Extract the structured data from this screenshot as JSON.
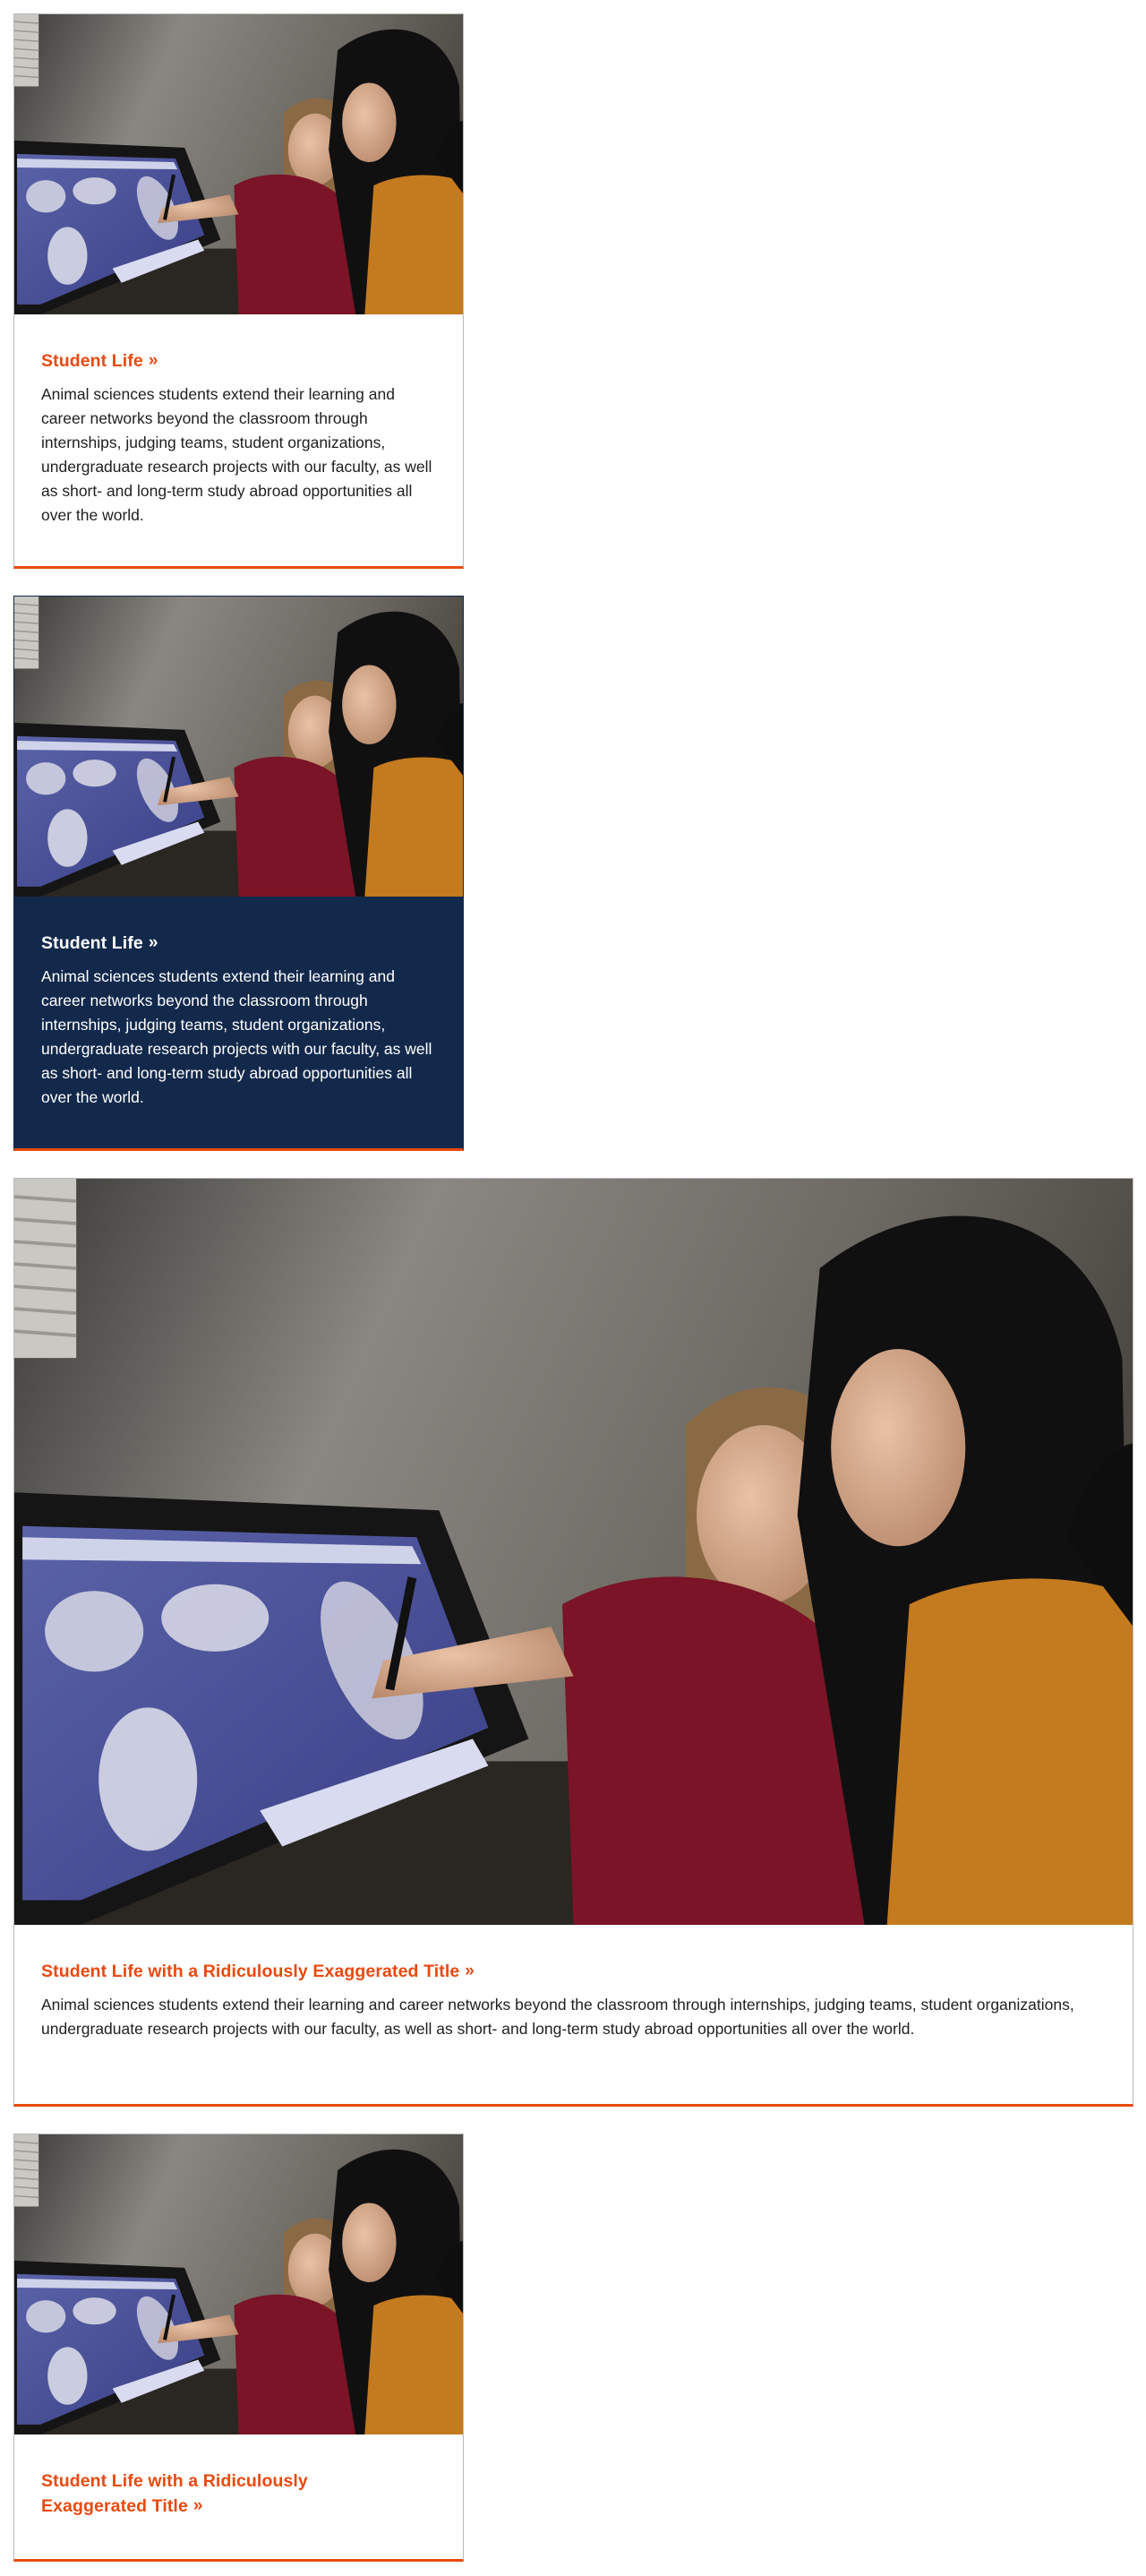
{
  "colors": {
    "accent_orange": "#e84a0f",
    "navy": "#13294b",
    "card_border": "#b9b9b9",
    "text": "#1f1f1f"
  },
  "cards": [
    {
      "variant": "white",
      "image_alt_icon": "photo-two-students-at-pen-display",
      "title": "Student Life",
      "chevron": "»",
      "text": "Animal sciences students extend their learning and career networks beyond the classroom through internships, judging teams, student organizations, undergraduate research projects with our faculty, as well as short- and long-term study abroad opportunities all over the world."
    },
    {
      "variant": "navy",
      "image_alt_icon": "photo-two-students-at-pen-display",
      "title": "Student Life",
      "chevron": "»",
      "text": "Animal sciences students extend their learning and career networks beyond the classroom through internships, judging teams, student organizations, undergraduate research projects with our faculty, as well as short- and long-term study abroad opportunities all over the world."
    },
    {
      "variant": "white-wide",
      "image_alt_icon": "photo-two-students-at-pen-display",
      "title": "Student Life with a Ridiculously Exaggerated Title",
      "chevron": "»",
      "text": "Animal sciences students extend their learning and career networks beyond the classroom through internships, judging teams, student organizations, undergraduate research projects with our faculty, as well as short- and long-term study abroad opportunities all over the world."
    },
    {
      "variant": "white",
      "image_alt_icon": "photo-two-students-at-pen-display",
      "title_line1": "Student Life with a Ridiculously",
      "title_line2": "Exaggerated Title",
      "chevron": "»"
    }
  ]
}
